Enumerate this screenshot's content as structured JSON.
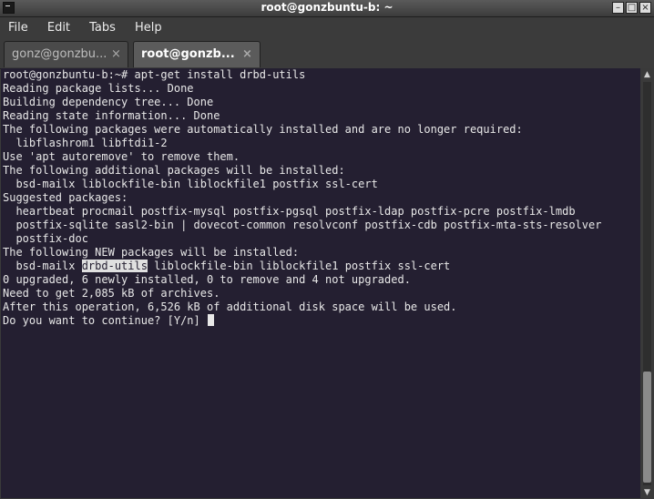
{
  "window": {
    "title": "root@gonzbuntu-b: ~",
    "buttons": {
      "minimize": "–",
      "maximize": "□",
      "close": "×"
    }
  },
  "menu": [
    "File",
    "Edit",
    "Tabs",
    "Help"
  ],
  "tabs": [
    {
      "label": "gonz@gonzbu...",
      "close": "×",
      "active": false
    },
    {
      "label": "root@gonzb...",
      "close": "×",
      "active": true
    }
  ],
  "terminal": {
    "lines": [
      "root@gonzbuntu-b:~# apt-get install drbd-utils",
      "Reading package lists... Done",
      "Building dependency tree... Done",
      "Reading state information... Done",
      "The following packages were automatically installed and are no longer required:",
      "  libflashrom1 libftdi1-2",
      "Use 'apt autoremove' to remove them.",
      "The following additional packages will be installed:",
      "  bsd-mailx liblockfile-bin liblockfile1 postfix ssl-cert",
      "Suggested packages:",
      "  heartbeat procmail postfix-mysql postfix-pgsql postfix-ldap postfix-pcre postfix-lmdb",
      "  postfix-sqlite sasl2-bin | dovecot-common resolvconf postfix-cdb postfix-mta-sts-resolver",
      "  postfix-doc",
      "The following NEW packages will be installed:",
      "0 upgraded, 6 newly installed, 0 to remove and 4 not upgraded.",
      "Need to get 2,085 kB of archives.",
      "After this operation, 6,526 kB of additional disk space will be used.",
      "Do you want to continue? [Y/n] "
    ],
    "new_pkgs": {
      "before": "  bsd-mailx ",
      "selected": "drbd-utils",
      "after": " liblockfile-bin liblockfile1 postfix ssl-cert"
    }
  },
  "scrollbar": {
    "up": "▲",
    "down": "▼"
  }
}
